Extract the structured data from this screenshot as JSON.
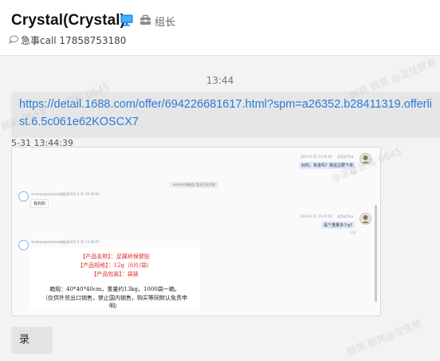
{
  "header": {
    "title": "Crystal(Crystal)",
    "role": "组长",
    "signature": "急事call 17858753180"
  },
  "chat": {
    "time_divider": "13:44",
    "link_message": {
      "text": "https://detail.1688.com/offer/694226681617.html?spm=a26352.b28411319.offerlist.6.5c061e62KOSCX7",
      "timestamp": "5-31 13:44:39"
    },
    "screenshot": {
      "right_msg_1": {
        "time": "2024-5-31 13:44:00",
        "sender": "金凯宏Tina",
        "text": "好的，有进吗？我这边要下单",
        "status": "已读"
      },
      "left_msg_1": {
        "sender": "wanbao@wanbao旗舰店",
        "time": "2024-5-31 09:46:02",
        "text": "有的的"
      },
      "system_notice": "wanbao旗舰店 暂无后续消息",
      "right_msg_2": {
        "time": "2024-5-31 13:45:05",
        "sender": "金凯宏Tina",
        "text": "是个重量多少g?",
        "status": "已读"
      },
      "left_msg_2": {
        "sender": "wanbao@wanbao旗舰店",
        "time": "2024-5-31 13:46:07"
      },
      "product": {
        "name_line": "【产品名称】：足踝矫保健贴",
        "spec_line": "【产品规格】：12g（6片/袋）",
        "pack_line": "【产品包装】：袋装",
        "box_line": "箱规：40*40*40cm，重量约13kg，1000袋一箱。",
        "note_line": "（仅供外贸出口销售，禁止国内销售，购买等同默认免责申",
        "note_line_2": "明）"
      }
    },
    "record_button": "录"
  },
  "watermarks": [
    "颜彩 0645",
    "颜彩 0645",
    "@淀佳贸易 0645",
    "颜亮 颜亮 @淀佳贸易",
    "颜亮 颜亮@淀佳贸"
  ]
}
